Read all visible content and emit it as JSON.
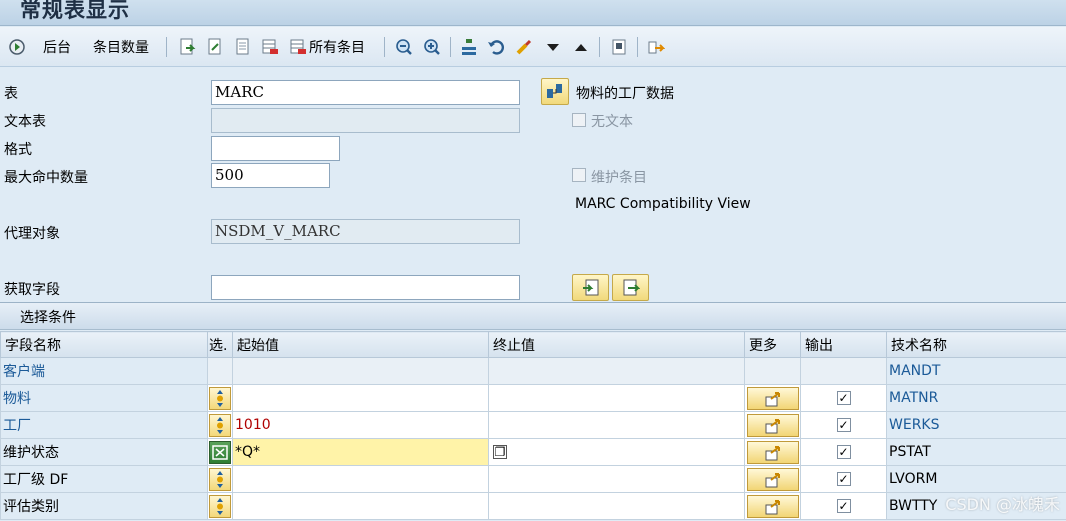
{
  "window": {
    "title": "常规表显示"
  },
  "toolbar": {
    "back_label": "后台",
    "count_label": "条目数量",
    "all_entries_label": "所有条目"
  },
  "form": {
    "table_label": "表",
    "table_value": "MARC",
    "table_desc": "物料的工厂数据",
    "text_table_label": "文本表",
    "text_table_value": "",
    "no_text_label": "无文本",
    "format_label": "格式",
    "format_value": "",
    "max_hits_label": "最大命中数量",
    "max_hits_value": "500",
    "maintain_entries_label": "维护条目",
    "view_desc": "MARC Compatibility View",
    "proxy_label": "代理对象",
    "proxy_value": "NSDM_V_MARC",
    "fetch_label": "获取字段",
    "fetch_value": ""
  },
  "selection": {
    "header": "选择条件",
    "columns": [
      "字段名称",
      "选.",
      "起始值",
      "终止值",
      "更多",
      "输出",
      "技术名称"
    ],
    "rows": [
      {
        "name": "客户端",
        "from": "",
        "to": "",
        "tech": "MANDT"
      },
      {
        "name": "物料",
        "from": "",
        "to": "",
        "tech": "MATNR"
      },
      {
        "name": "工厂",
        "from": "1010",
        "to": "",
        "tech": "WERKS"
      },
      {
        "name": "维护状态",
        "from": "*Q*",
        "to": "",
        "tech": "PSTAT"
      },
      {
        "name": "工厂级 DF",
        "from": "",
        "to": "",
        "tech": "LVORM"
      },
      {
        "name": "评估类别",
        "from": "",
        "to": "",
        "tech": "BWTTY"
      }
    ]
  },
  "watermark": "CSDN @冰魄禾"
}
